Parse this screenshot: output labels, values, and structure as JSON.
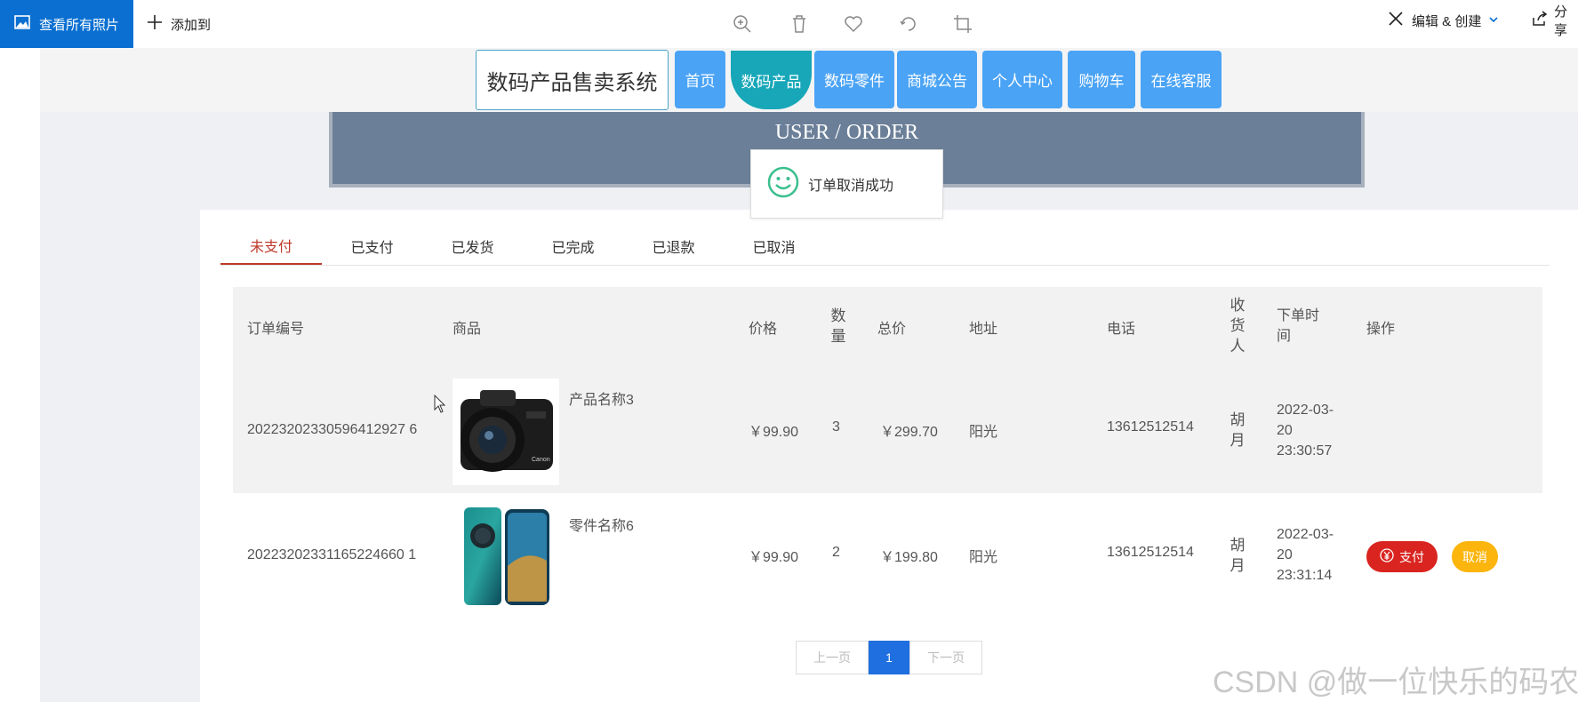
{
  "viewer": {
    "view_all_photos": "查看所有照片",
    "add_to": "添加到",
    "edit_create": "编辑 & 创建",
    "share": "分享"
  },
  "site": {
    "title": "数码产品售卖系统",
    "nav": [
      "首页",
      "数码产品",
      "数码零件",
      "商城公告",
      "个人中心",
      "购物车",
      "在线客服"
    ],
    "active_nav": "数码产品"
  },
  "banner": {
    "title": "USER / ORDER"
  },
  "toast": {
    "message": "订单取消成功"
  },
  "tabs": [
    "未支付",
    "已支付",
    "已发货",
    "已完成",
    "已退款",
    "已取消"
  ],
  "active_tab": "未支付",
  "table": {
    "headers": {
      "order_no": "订单编号",
      "product": "商品",
      "price": "价格",
      "quantity": "数量",
      "total": "总价",
      "address": "地址",
      "phone": "电话",
      "receiver": "收货人",
      "order_time": "下单时间",
      "actions": "操作"
    },
    "rows": [
      {
        "order_no": "20223202330596412927 6",
        "product_name": "产品名称3",
        "price": "￥99.90",
        "quantity": "3",
        "total": "￥299.70",
        "address": "阳光",
        "phone": "13612512514",
        "receiver": "胡月",
        "order_time": "2022-03-20 23:30:57"
      },
      {
        "order_no": "20223202331165224660 1",
        "product_name": "零件名称6",
        "price": "￥99.90",
        "quantity": "2",
        "total": "￥199.80",
        "address": "阳光",
        "phone": "13612512514",
        "receiver": "胡月",
        "order_time": "2022-03-20 23:31:14"
      }
    ]
  },
  "actions": {
    "pay": "支付",
    "cancel": "取消"
  },
  "pager": {
    "prev": "上一页",
    "current": "1",
    "next": "下一页"
  },
  "watermark": "CSDN @做一位快乐的码农"
}
